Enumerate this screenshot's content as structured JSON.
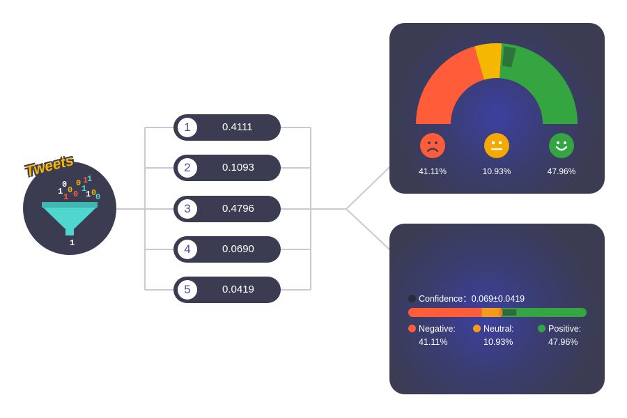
{
  "source": {
    "label": "Tweets",
    "digits": [
      "0",
      "0",
      "1",
      "1",
      "1",
      "0",
      "0",
      "1",
      "1",
      "0",
      "1",
      "0",
      "1"
    ]
  },
  "scores": [
    {
      "index": "1",
      "value": "0.4111"
    },
    {
      "index": "2",
      "value": "0.1093"
    },
    {
      "index": "3",
      "value": "0.4796"
    },
    {
      "index": "4",
      "value": "0.0690"
    },
    {
      "index": "5",
      "value": "0.0419"
    }
  ],
  "gauge": {
    "negative": {
      "value": 0.4111,
      "label": "41.11%",
      "color": "#ff5c3a",
      "icon": "frown-face-icon"
    },
    "neutral": {
      "value": 0.1093,
      "label": "10.93%",
      "color": "#f5a800",
      "icon": "neutral-face-icon"
    },
    "positive": {
      "value": 0.4796,
      "label": "47.96%",
      "color": "#35a541",
      "icon": "smile-face-icon"
    },
    "confidence_band_color": "#2c6b3a"
  },
  "confidence": {
    "label": "Confidence：0.069±0.0419",
    "center": 0.069,
    "spread": 0.0419
  },
  "legend": [
    {
      "name": "Negative:",
      "value": "41.11%",
      "color": "#ff5c3a"
    },
    {
      "name": "Neutral:",
      "value": "10.93%",
      "color": "#f59a1b"
    },
    {
      "name": "Positive:",
      "value": "47.96%",
      "color": "#35a541"
    }
  ],
  "colors": {
    "panel": "#3b3c52",
    "accent": "#4a4fa8",
    "connector": "#c7c9d6",
    "funnel": "#4fd6cf"
  }
}
